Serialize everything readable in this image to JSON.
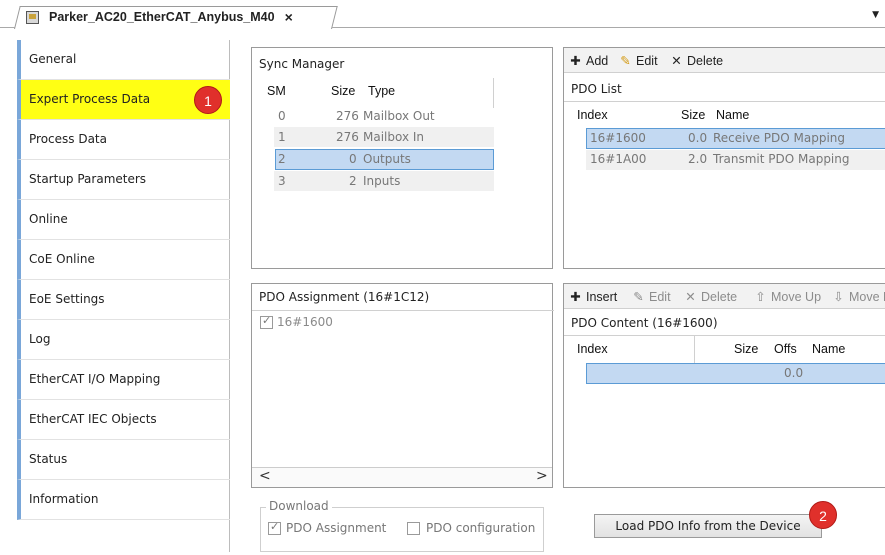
{
  "doc_tab": {
    "title": "Parker_AC20_EtherCAT_Anybus_M40",
    "close": "×"
  },
  "sidebar": {
    "items": [
      {
        "label": "General"
      },
      {
        "label": "Expert Process Data"
      },
      {
        "label": "Process Data"
      },
      {
        "label": "Startup Parameters"
      },
      {
        "label": "Online"
      },
      {
        "label": "CoE Online"
      },
      {
        "label": "EoE Settings"
      },
      {
        "label": "Log"
      },
      {
        "label": "EtherCAT I/O Mapping"
      },
      {
        "label": "EtherCAT IEC Objects"
      },
      {
        "label": "Status"
      },
      {
        "label": "Information"
      }
    ],
    "badge": "1"
  },
  "sync_manager": {
    "title": "Sync Manager",
    "headers": {
      "sm": "SM",
      "size": "Size",
      "type": "Type"
    },
    "rows": [
      {
        "sm": "0",
        "size": "276",
        "type": "Mailbox Out"
      },
      {
        "sm": "1",
        "size": "276",
        "type": "Mailbox In"
      },
      {
        "sm": "2",
        "size": "0",
        "type": "Outputs"
      },
      {
        "sm": "3",
        "size": "2",
        "type": "Inputs"
      }
    ]
  },
  "pdo_list": {
    "toolbar": {
      "add": "Add",
      "edit": "Edit",
      "delete": "Delete"
    },
    "title": "PDO List",
    "headers": {
      "index": "Index",
      "size": "Size",
      "name": "Name"
    },
    "rows": [
      {
        "index": "16#1600",
        "size": "0.0",
        "name": "Receive PDO Mapping"
      },
      {
        "index": "16#1A00",
        "size": "2.0",
        "name": "Transmit PDO Mapping"
      }
    ]
  },
  "pdo_assignment": {
    "title": "PDO Assignment (16#1C12)",
    "items": [
      {
        "label": "16#1600",
        "checked": true
      }
    ],
    "scroll_left": "<",
    "scroll_right": ">"
  },
  "pdo_content": {
    "toolbar": {
      "insert": "Insert",
      "edit": "Edit",
      "delete": "Delete",
      "move_up": "Move Up",
      "move_down": "Move D"
    },
    "title": "PDO Content (16#1600)",
    "headers": {
      "index": "Index",
      "size": "Size",
      "offs": "Offs",
      "name": "Name"
    },
    "rows": [
      {
        "index": "",
        "size": "",
        "offs": "0.0",
        "name": ""
      }
    ]
  },
  "download": {
    "legend": "Download",
    "pdo_assignment": "PDO Assignment",
    "pdo_assignment_checked": true,
    "pdo_configuration": "PDO configuration",
    "pdo_configuration_checked": false
  },
  "load_button": {
    "label": "Load PDO Info from the Device",
    "badge": "2"
  },
  "colors": {
    "highlight": "#ffff14",
    "badge": "#e0302b",
    "selection": "#c3d9f2",
    "accent_bar": "#7aa7d9"
  }
}
